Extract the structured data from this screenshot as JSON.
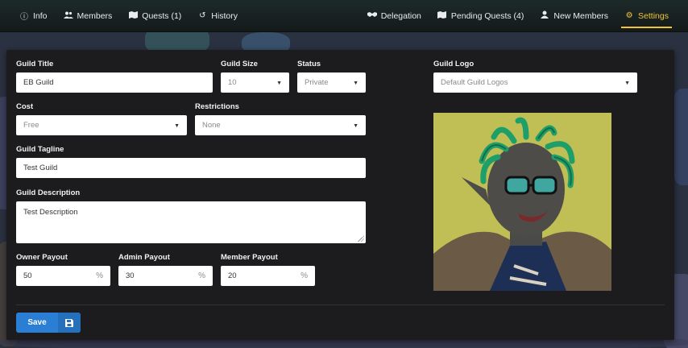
{
  "nav": {
    "left_tabs": [
      {
        "label": "Info",
        "icon": "info-circle-icon"
      },
      {
        "label": "Members",
        "icon": "users-icon"
      },
      {
        "label": "Quests (1)",
        "icon": "map-icon"
      },
      {
        "label": "History",
        "icon": "history-icon"
      }
    ],
    "right_tabs": [
      {
        "label": "Delegation",
        "icon": "handshake-icon"
      },
      {
        "label": "Pending Quests (4)",
        "icon": "map-icon"
      },
      {
        "label": "New Members",
        "icon": "user-icon"
      },
      {
        "label": "Settings",
        "icon": "gear-icon",
        "active": true
      }
    ],
    "active_color": "#f4c430"
  },
  "form": {
    "guild_title": {
      "label": "Guild Title",
      "value": "EB Guild"
    },
    "guild_size": {
      "label": "Guild Size",
      "value": "10"
    },
    "status": {
      "label": "Status",
      "value": "Private"
    },
    "guild_logo": {
      "label": "Guild Logo",
      "value": "Default Guild Logos"
    },
    "cost": {
      "label": "Cost",
      "value": "Free"
    },
    "restrictions": {
      "label": "Restrictions",
      "value": "None"
    },
    "guild_tagline": {
      "label": "Guild Tagline",
      "value": "Test Guild"
    },
    "guild_description": {
      "label": "Guild Description",
      "value": "Test Description"
    },
    "owner_payout": {
      "label": "Owner Payout",
      "value": "50",
      "unit": "%"
    },
    "admin_payout": {
      "label": "Admin Payout",
      "value": "30",
      "unit": "%"
    },
    "member_payout": {
      "label": "Member Payout",
      "value": "20",
      "unit": "%"
    },
    "save_label": "Save"
  },
  "colors": {
    "panel_bg": "#1c1c1e",
    "save_button": "#2a7fd4",
    "logo_bg": "#bfbf55"
  }
}
